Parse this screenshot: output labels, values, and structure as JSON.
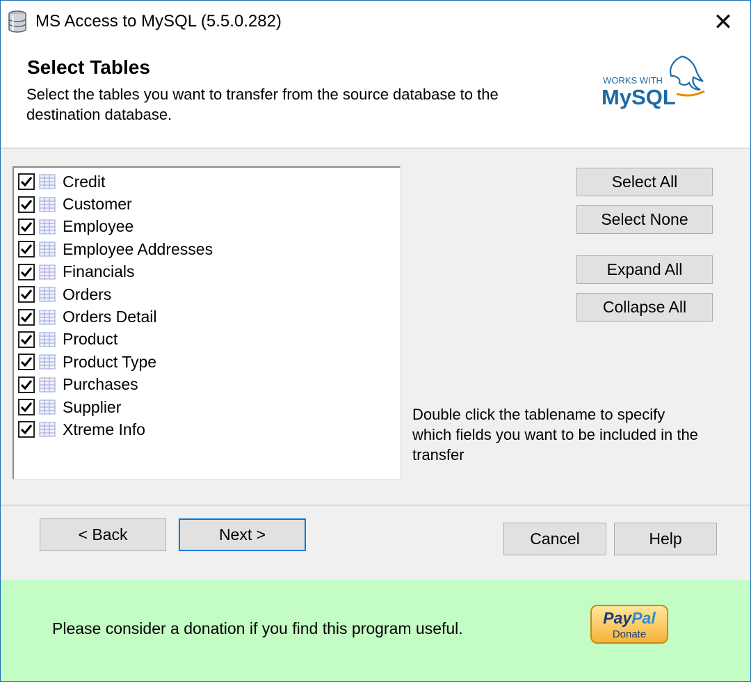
{
  "window": {
    "title": "MS Access to MySQL (5.5.0.282)",
    "close_symbol": "✕"
  },
  "header": {
    "title": "Select Tables",
    "description": "Select the tables you want to transfer from the source database to the destination database.",
    "logo": {
      "small_text": "WORKS WITH",
      "big_text": "MySQL"
    }
  },
  "tables": [
    {
      "label": "Credit",
      "checked": true
    },
    {
      "label": "Customer",
      "checked": true
    },
    {
      "label": "Employee",
      "checked": true
    },
    {
      "label": "Employee Addresses",
      "checked": true
    },
    {
      "label": "Financials",
      "checked": true
    },
    {
      "label": "Orders",
      "checked": true
    },
    {
      "label": "Orders Detail",
      "checked": true
    },
    {
      "label": "Product",
      "checked": true
    },
    {
      "label": "Product Type",
      "checked": true
    },
    {
      "label": "Purchases",
      "checked": true
    },
    {
      "label": "Supplier",
      "checked": true
    },
    {
      "label": "Xtreme Info",
      "checked": true
    }
  ],
  "actions": {
    "select_all": "Select All",
    "select_none": "Select None",
    "expand_all": "Expand All",
    "collapse_all": "Collapse All"
  },
  "hint": "Double click the tablename to specify which fields you want to be included in the transfer",
  "nav": {
    "back": "< Back",
    "next": "Next >",
    "cancel": "Cancel",
    "help": "Help"
  },
  "donation": {
    "text": "Please consider a donation if you find this program useful.",
    "paypal_pay": "Pay",
    "paypal_pal": "Pal",
    "paypal_donate": "Donate"
  },
  "colors": {
    "accent": "#0078d7",
    "donation_bg": "#c3fdc3",
    "mysql_blue": "#1d6aa5",
    "mysql_orange": "#e48e00"
  }
}
